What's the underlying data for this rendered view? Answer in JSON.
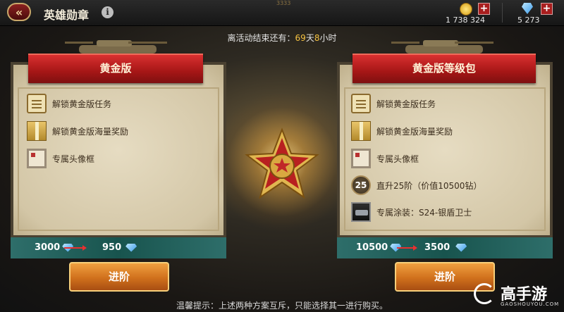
{
  "header": {
    "title": "英雄勋章",
    "ticker": "3333",
    "gold_value": "1 738 324",
    "diamond_value": "5 273"
  },
  "countdown": {
    "prefix": "离活动结束还有：",
    "days": "69",
    "days_unit": "天",
    "hours": "8",
    "hours_unit": "小时"
  },
  "left_panel": {
    "title": "黄金版",
    "items": [
      {
        "label": "解锁黄金版任务",
        "icon": "scroll-icon"
      },
      {
        "label": "解锁黄金版海量奖励",
        "icon": "gift-icon"
      },
      {
        "label": "专属头像框",
        "icon": "avatar-frame-icon"
      }
    ],
    "old_price": "3000",
    "new_price": "950",
    "button": "进阶"
  },
  "right_panel": {
    "title": "黄金版等级包",
    "items": [
      {
        "label": "解锁黄金版任务",
        "icon": "scroll-icon"
      },
      {
        "label": "解锁黄金版海量奖励",
        "icon": "gift-icon"
      },
      {
        "label": "专属头像框",
        "icon": "avatar-frame-icon"
      },
      {
        "label": "直升25阶（价值10500钻）",
        "icon": "level-badge-icon",
        "badge": "25"
      },
      {
        "label": "专属涂装：S24-银盾卫士",
        "icon": "tank-skin-icon"
      }
    ],
    "old_price": "10500",
    "new_price": "3500",
    "button": "进阶"
  },
  "footer": {
    "note": "温馨提示：上述两种方案互斥，只能选择其一进行购买。"
  },
  "watermark": {
    "brand": "高手游",
    "domain": "GAOSHOUYOU.COM"
  },
  "colors": {
    "ribbon_red": "#c82222",
    "accent_gold": "#f5c242",
    "button_orange": "#e0801e",
    "price_bar_teal": "#1f5e58"
  }
}
